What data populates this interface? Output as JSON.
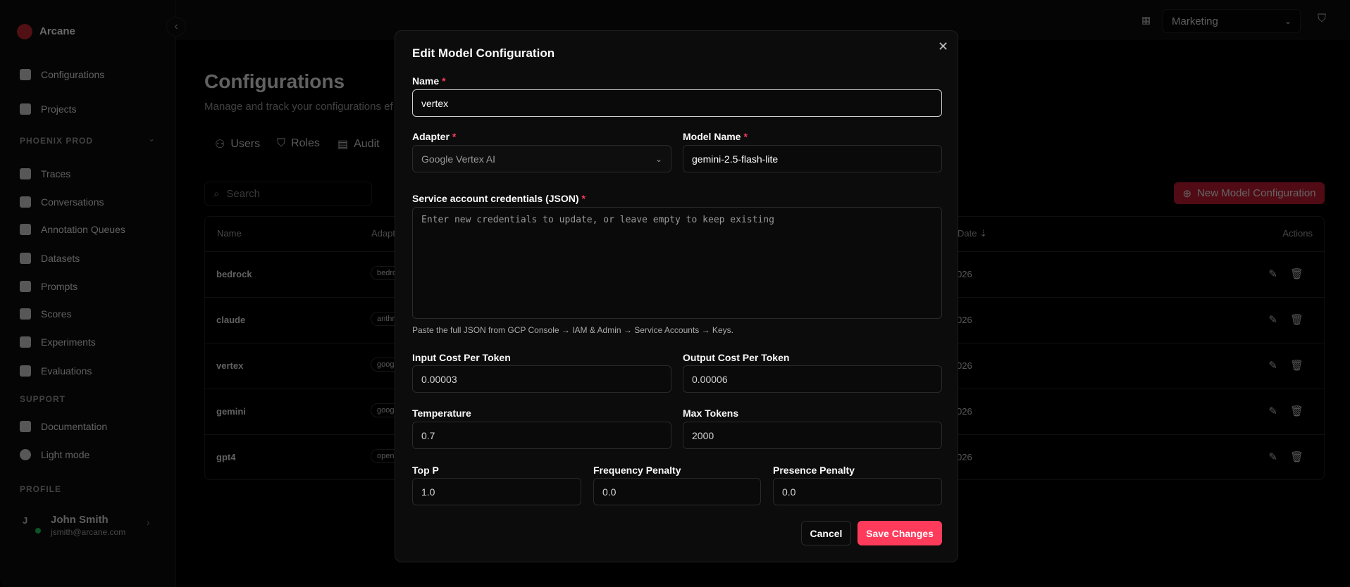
{
  "app": {
    "name": "Arcane",
    "brand_color": "#e0313a"
  },
  "sidebar": {
    "top_items": [
      {
        "label": "Configurations",
        "icon": "gear-icon"
      },
      {
        "label": "Projects",
        "icon": "folder-icon"
      }
    ],
    "project_section": "PHOENIX PROD",
    "project_items": [
      {
        "label": "Traces",
        "icon": "grid-icon"
      },
      {
        "label": "Conversations",
        "icon": "chat-icon"
      },
      {
        "label": "Annotation Queues",
        "icon": "calendar-edit-icon"
      },
      {
        "label": "Datasets",
        "icon": "database-icon"
      },
      {
        "label": "Prompts",
        "icon": "prompt-icon"
      },
      {
        "label": "Scores",
        "icon": "bulb-icon"
      },
      {
        "label": "Experiments",
        "icon": "flask-icon"
      },
      {
        "label": "Evaluations",
        "icon": "gauge-icon"
      }
    ],
    "support_section": "SUPPORT",
    "support_items": [
      {
        "label": "Documentation",
        "icon": "document-icon"
      },
      {
        "label": "Light mode",
        "icon": "sun-icon"
      }
    ],
    "profile_section": "PROFILE",
    "profile": {
      "initial": "J",
      "name": "John Smith",
      "email": "jsmith@arcane.com",
      "status_color": "#22c55e"
    }
  },
  "header": {
    "org_select": "Marketing"
  },
  "page": {
    "title": "Configurations",
    "subtitle": "Manage and track your configurations ef",
    "tabs": [
      {
        "label": "Users"
      },
      {
        "label": "Roles"
      },
      {
        "label": "Audit"
      }
    ],
    "search_placeholder": "Search",
    "new_button": "New Model Configuration",
    "columns": {
      "name": "Name",
      "adapter": "Adapt",
      "date": "Date",
      "actions": "Actions"
    },
    "rows": [
      {
        "name": "bedrock",
        "adapter": "bedro",
        "date": "026"
      },
      {
        "name": "claude",
        "adapter": "anthr",
        "date": "026"
      },
      {
        "name": "vertex",
        "adapter": "goog",
        "date": "026"
      },
      {
        "name": "gemini",
        "adapter": "goog",
        "date": "026"
      },
      {
        "name": "gpt4",
        "adapter": "open",
        "date": "026"
      }
    ]
  },
  "modal": {
    "title": "Edit Model Configuration",
    "name_label": "Name",
    "name_value": "vertex",
    "adapter_label": "Adapter",
    "adapter_value": "Google Vertex AI",
    "model_label": "Model Name",
    "model_value": "gemini-2.5-flash-lite",
    "creds_label": "Service account credentials (JSON)",
    "creds_placeholder": "Enter new credentials to update, or leave empty to keep existing",
    "creds_help": "Paste the full JSON from GCP Console → IAM & Admin → Service Accounts → Keys.",
    "input_cost_label": "Input Cost Per Token",
    "input_cost": "0.00003",
    "output_cost_label": "Output Cost Per Token",
    "output_cost": "0.00006",
    "temperature_label": "Temperature",
    "temperature": "0.7",
    "max_tokens_label": "Max Tokens",
    "max_tokens": "2000",
    "top_p_label": "Top P",
    "top_p": "1.0",
    "freq_label": "Frequency Penalty",
    "freq": "0.0",
    "presence_label": "Presence Penalty",
    "presence": "0.0",
    "required_mark": "*",
    "cancel": "Cancel",
    "save": "Save Changes",
    "save_color": "#ff3b5c"
  }
}
